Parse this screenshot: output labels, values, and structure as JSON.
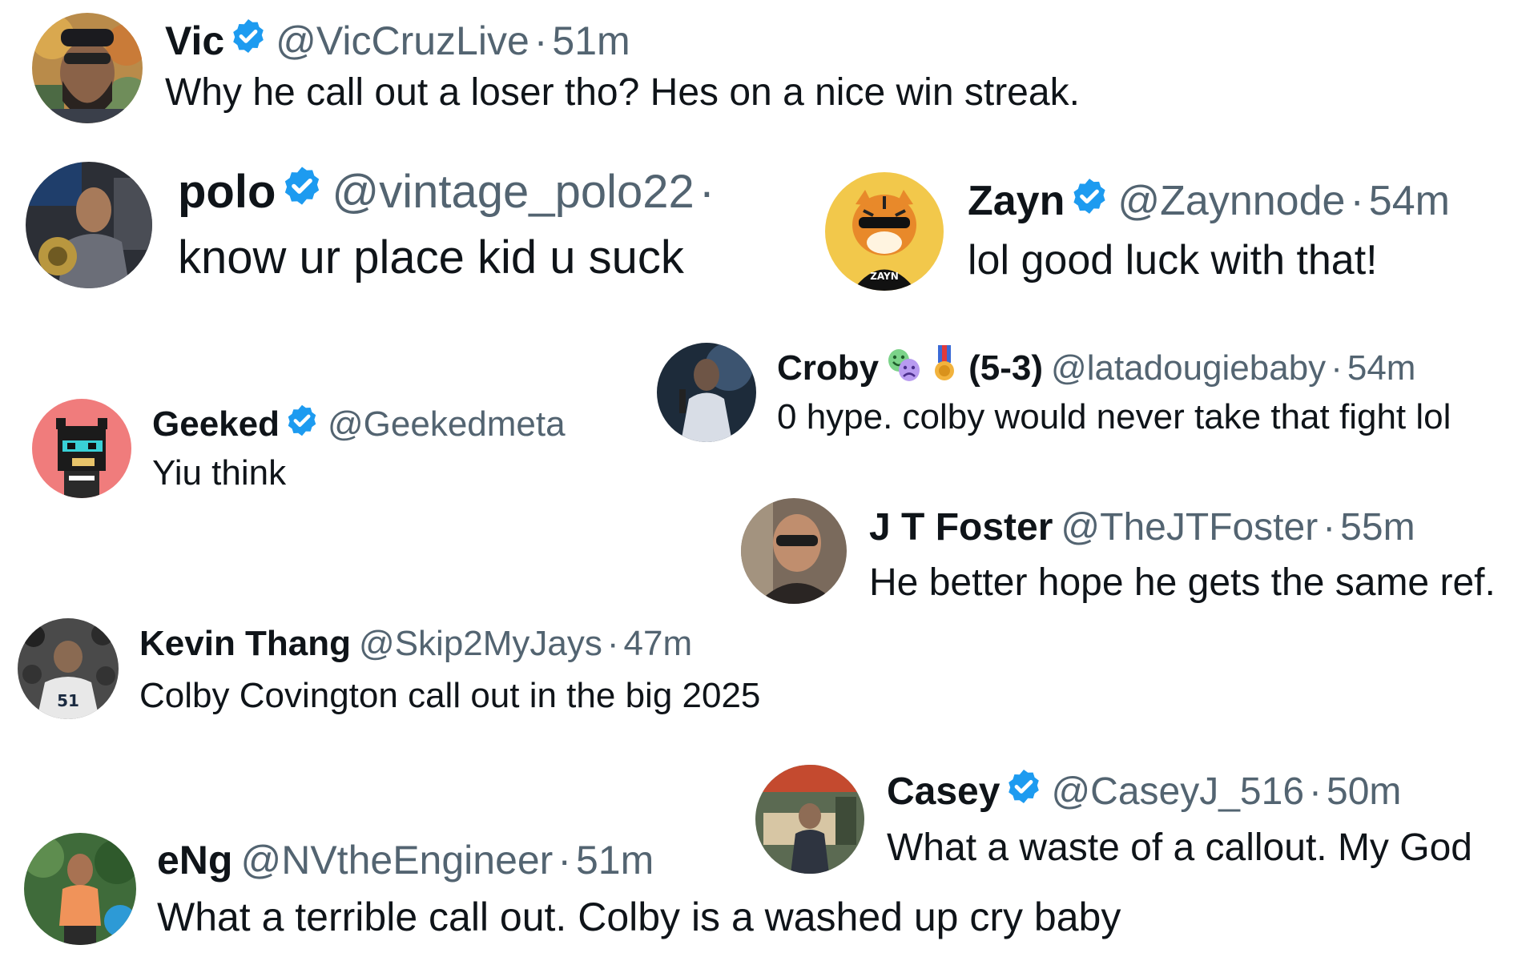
{
  "replies": [
    {
      "name": "Vic",
      "handle": "@VicCruzLive",
      "dot": "·",
      "time": "51m",
      "text": "Why he call out a loser tho? Hes on a nice win streak.",
      "verified": true
    },
    {
      "name": "polo",
      "handle": "@vintage_polo22",
      "dot": "·",
      "time": "",
      "text": "know ur place kid u suck",
      "verified": true
    },
    {
      "name": "Zayn",
      "handle": "@Zaynnode",
      "dot": "·",
      "time": "54m",
      "text": "lol good luck with that!",
      "verified": true,
      "avatar_text": "ZAYN"
    },
    {
      "name": "Croby",
      "record": "(5-3)",
      "handle": "@latadougiebaby",
      "dot": "·",
      "time": "54m",
      "text": "0 hype. colby would never take that fight lol",
      "verified": false,
      "emojis": [
        "performing-arts-emoji",
        "military-medal-emoji"
      ]
    },
    {
      "name": "Geeked",
      "handle": "@Geekedmeta",
      "dot": "",
      "time": "",
      "text": "Yiu think",
      "verified": true
    },
    {
      "name": "J T Foster",
      "handle": "@TheJTFoster",
      "dot": "·",
      "time": "55m",
      "text": "He better hope he gets the same ref.",
      "verified": false
    },
    {
      "name": "Kevin Thang",
      "handle": "@Skip2MyJays",
      "dot": "·",
      "time": "47m",
      "text": "Colby Covington call out in the big 2025",
      "verified": false,
      "avatar_text": "51"
    },
    {
      "name": "Casey",
      "handle": "@CaseyJ_516",
      "dot": "·",
      "time": "50m",
      "text": "What a waste of a callout. My God",
      "verified": true
    },
    {
      "name": "eNg",
      "handle": "@NVtheEngineer",
      "dot": "·",
      "time": "51m",
      "text": "What a terrible call out. Colby is a washed up cry baby",
      "verified": false
    }
  ],
  "colors": {
    "verified_blue": "#1d9bf0",
    "handle_gray": "#536471",
    "text_dark": "#0f1419",
    "background": "#ffffff"
  }
}
